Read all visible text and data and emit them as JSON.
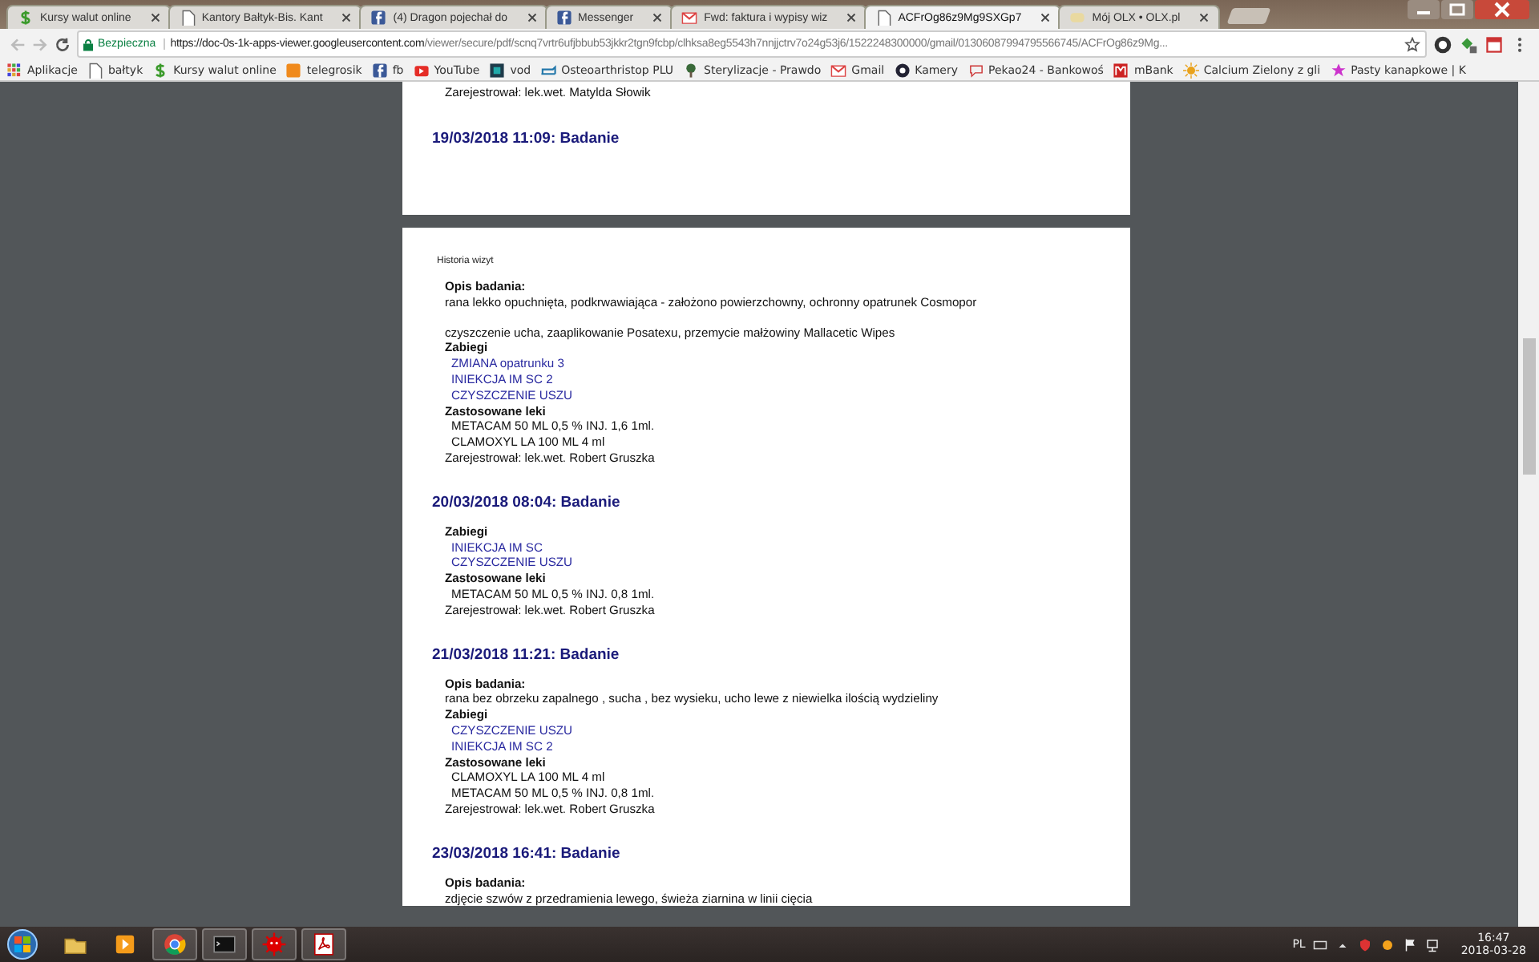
{
  "tabs": [
    {
      "title": "Kursy walut online",
      "selected": false
    },
    {
      "title": "Kantory Bałtyk-Bis. Kant",
      "selected": false
    },
    {
      "title": "(4) Dragon pojechał do",
      "selected": false
    },
    {
      "title": "Messenger",
      "selected": false
    },
    {
      "title": "Fwd: faktura i wypisy wiz",
      "selected": false
    },
    {
      "title": "ACFrOg86z9Mg9SXGp7",
      "selected": true
    },
    {
      "title": "Mój OLX • OLX.pl",
      "selected": false
    }
  ],
  "toolbar": {
    "security": "Bezpieczna",
    "url_host": "https://doc-0s-1k-apps-viewer.googleusercontent.com",
    "url_path": "/viewer/secure/pdf/scnq7vrtr6ufjbbub53jkkr2tgn9fcbp/clhksa8eg5543h7nnjjctrv7o24g53j6/1522248300000/gmail/01306087994795566745/ACFrOg86z9Mg..."
  },
  "bookmarks": [
    "Aplikacje",
    "bałtyk",
    "Kursy walut online",
    "telegrosik",
    "fb",
    "YouTube",
    "vod",
    "Osteoarthristop PLU",
    "Sterylizacje - Prawdo",
    "Gmail",
    "Kamery",
    "Pekao24 - Bankowoś",
    "mBank",
    "Calcium Zielony z gli",
    "Pasty kanapkowe | K"
  ],
  "pages": [
    {
      "blocks": [
        {
          "kind": "registered",
          "text": "Zarejestrował: lek.wet. Matylda Słowik"
        },
        {
          "kind": "heading",
          "text": "19/03/2018 11:09: Badanie"
        }
      ]
    },
    {
      "header": "Historia wizyt",
      "blocks": [
        {
          "kind": "label",
          "text": "Opis badania:"
        },
        {
          "kind": "description",
          "lines": [
            "rana lekko opuchnięta, podkrwawiająca - założono powierzchowny, ochronny opatrunek Cosmopor",
            "czyszczenie ucha, zaaplikowanie Posatexu, przemycie małżowiny Mallacetic Wipes"
          ]
        },
        {
          "kind": "label",
          "text": "Zabiegi"
        },
        {
          "kind": "procedure",
          "text": "ZMIANA opatrunku 3"
        },
        {
          "kind": "procedure",
          "text": "INIEKCJA IM SC 2"
        },
        {
          "kind": "procedure",
          "text": "CZYSZCZENIE USZU"
        },
        {
          "kind": "label",
          "text": "Zastosowane leki"
        },
        {
          "kind": "drug",
          "text": "METACAM 50 ML 0,5 % INJ. 1,6 1ml."
        },
        {
          "kind": "drug",
          "text": "CLAMOXYL LA 100 ML 4 ml"
        },
        {
          "kind": "registered",
          "text": "Zarejestrował: lek.wet. Robert Gruszka"
        },
        {
          "kind": "heading",
          "text": "20/03/2018 08:04: Badanie"
        },
        {
          "kind": "label",
          "text": "Zabiegi"
        },
        {
          "kind": "procedure",
          "text": "INIEKCJA IM SC"
        },
        {
          "kind": "procedure",
          "text": "CZYSZCZENIE USZU"
        },
        {
          "kind": "label",
          "text": "Zastosowane leki"
        },
        {
          "kind": "drug",
          "text": "METACAM 50 ML 0,5 % INJ. 0,8 1ml."
        },
        {
          "kind": "registered",
          "text": "Zarejestrował: lek.wet. Robert Gruszka"
        },
        {
          "kind": "heading",
          "text": "21/03/2018 11:21: Badanie"
        },
        {
          "kind": "label",
          "text": "Opis badania:"
        },
        {
          "kind": "description",
          "lines": [
            "rana bez obrzeku zapalnego , sucha , bez wysieku, ucho lewe z niewielka ilością wydzieliny"
          ]
        },
        {
          "kind": "label",
          "text": "Zabiegi"
        },
        {
          "kind": "procedure",
          "text": "CZYSZCZENIE USZU"
        },
        {
          "kind": "procedure",
          "text": "INIEKCJA IM SC 2"
        },
        {
          "kind": "label",
          "text": "Zastosowane leki"
        },
        {
          "kind": "drug",
          "text": "CLAMOXYL LA 100 ML 4 ml"
        },
        {
          "kind": "drug",
          "text": "METACAM 50 ML 0,5 % INJ. 0,8 1ml."
        },
        {
          "kind": "registered",
          "text": "Zarejestrował: lek.wet. Robert Gruszka"
        },
        {
          "kind": "heading",
          "text": "23/03/2018 16:41: Badanie"
        },
        {
          "kind": "label",
          "text": "Opis badania:"
        },
        {
          "kind": "description",
          "lines": [
            "zdjęcie szwów z przedramienia lewego, świeża ziarnina w linii cięcia"
          ]
        }
      ]
    }
  ],
  "taskbar": {
    "language": "PL",
    "time": "16:47",
    "date": "2018-03-28"
  }
}
